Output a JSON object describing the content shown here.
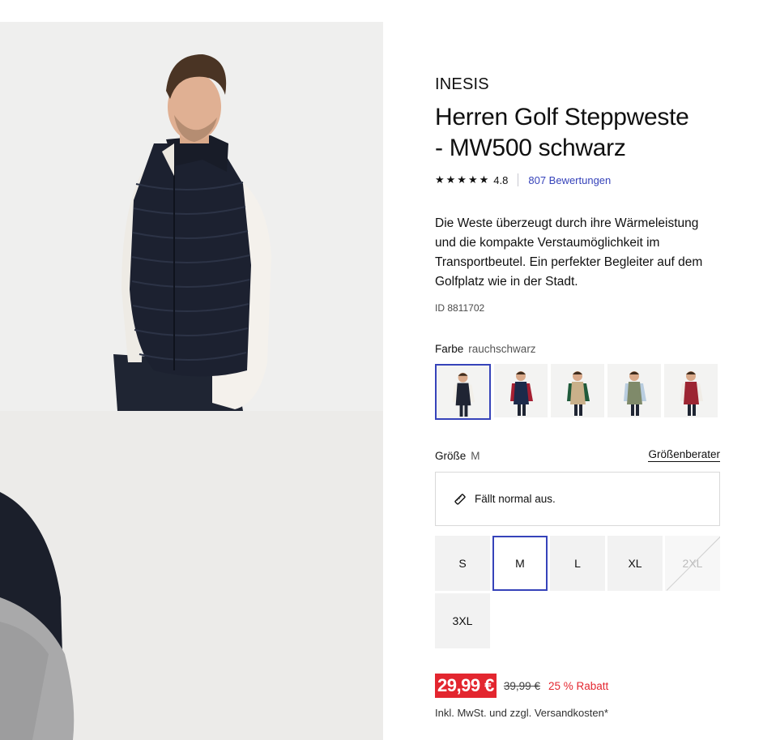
{
  "product": {
    "brand": "INESIS",
    "title_line1": "Herren Golf Steppweste",
    "title_line2": "- MW500 schwarz",
    "stars": "★★★★★",
    "rating": "4.8",
    "reviews": "807 Bewertungen",
    "description": "Die Weste überzeugt durch ihre Wärmeleistung und die kompakte Verstaumöglichkeit im Transportbeutel. Ein perfekter Begleiter auf dem Golfplatz wie in der Stadt.",
    "id": "ID 8811702"
  },
  "color": {
    "label": "Farbe",
    "selected": "rauchschwarz",
    "swatches": [
      {
        "color": "#1f2433",
        "shirt": "#f2efe9",
        "name": "rauchschwarz"
      },
      {
        "color": "#1c2a4a",
        "shirt": "#a51f32",
        "name": "navy"
      },
      {
        "color": "#c9b08a",
        "shirt": "#1f5a3a",
        "name": "beige"
      },
      {
        "color": "#7f8a6a",
        "shirt": "#b9cde0",
        "name": "khaki"
      },
      {
        "color": "#9c2532",
        "shirt": "#f0ece6",
        "name": "bordeaux"
      }
    ]
  },
  "size": {
    "label": "Größe",
    "selected": "M",
    "advisor": "Größenberater",
    "fit": "Fällt normal aus.",
    "options": [
      "S",
      "M",
      "L",
      "XL",
      "2XL",
      "3XL"
    ]
  },
  "price": {
    "current": "29,99 €",
    "old": "39,99 €",
    "discount": "25 % Rabatt",
    "tax": "Inkl. MwSt. und zzgl. Versandkosten*"
  },
  "colors": {
    "accent": "#3643ba",
    "sale": "#e3262f"
  }
}
